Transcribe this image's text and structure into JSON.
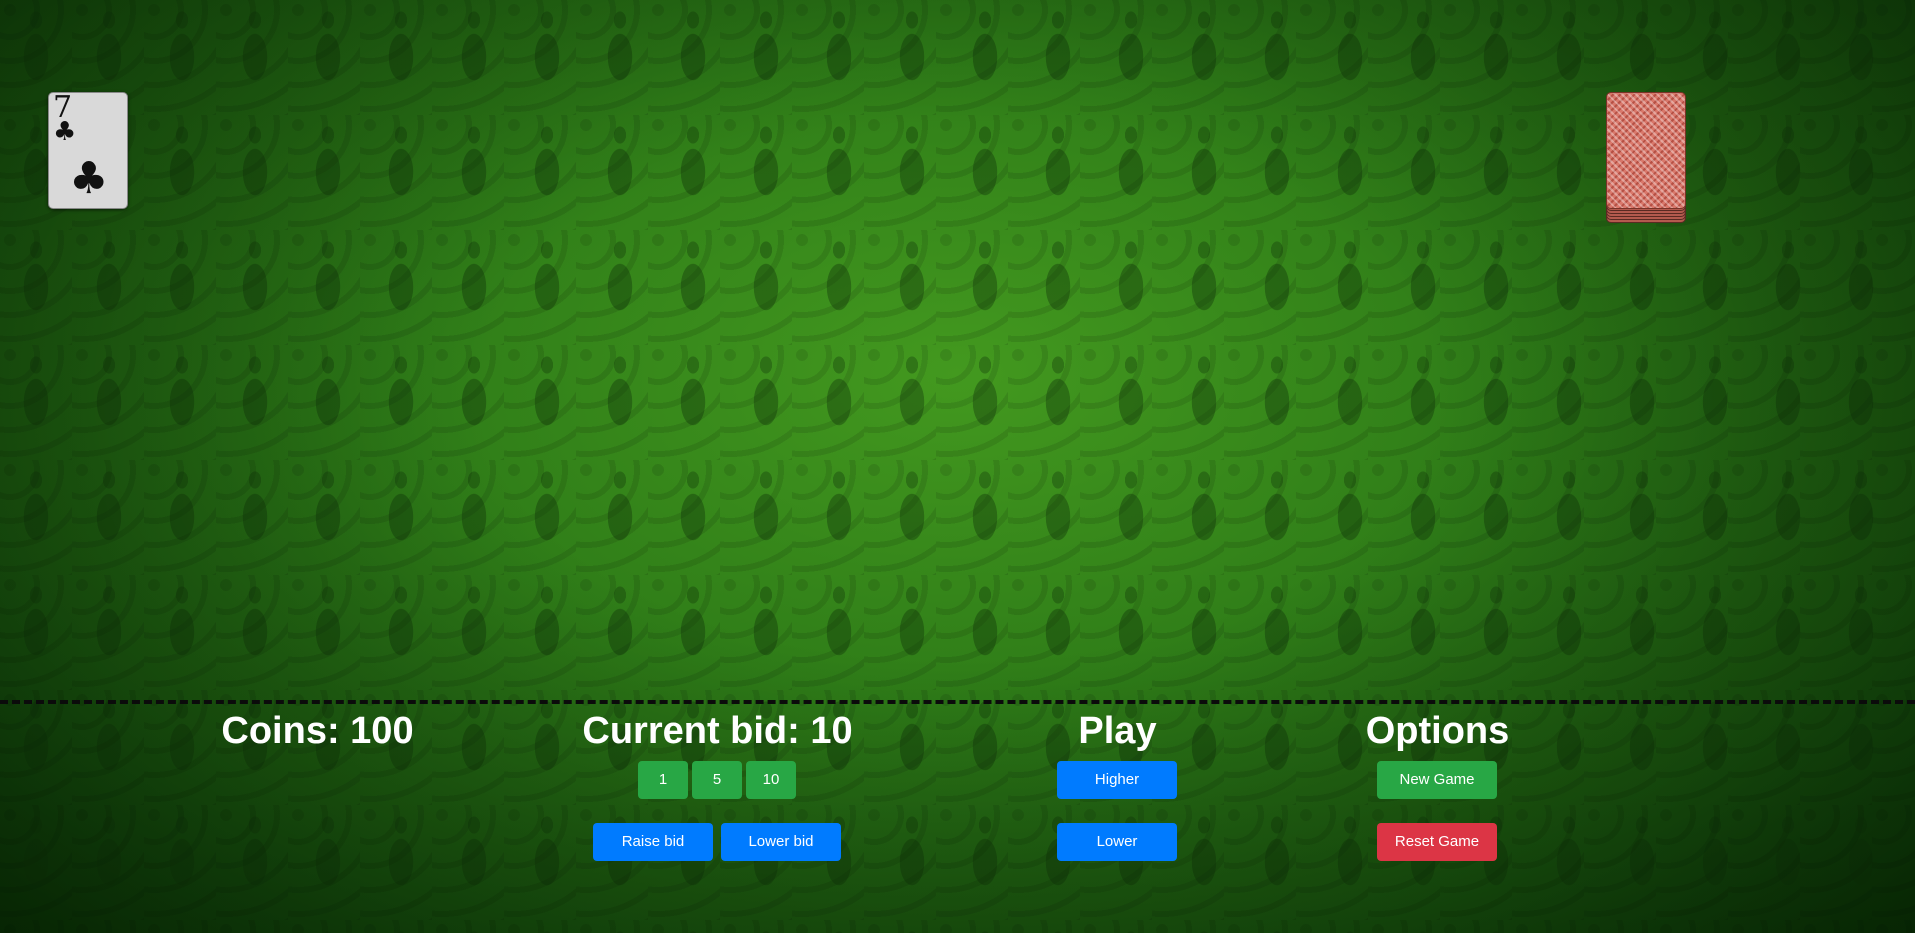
{
  "player_card": {
    "rank": "7",
    "suit": "♣",
    "suit_name": "clubs"
  },
  "deck": {
    "label": "card-back"
  },
  "coins": {
    "title": "Coins: 100",
    "value": 100
  },
  "bid": {
    "title": "Current bid: 10",
    "value": 10,
    "chips": [
      "1",
      "5",
      "10"
    ],
    "raise_label": "Raise bid",
    "lower_label": "Lower bid"
  },
  "play": {
    "title": "Play",
    "higher_label": "Higher",
    "lower_label": "Lower"
  },
  "options": {
    "title": "Options",
    "new_game_label": "New Game",
    "reset_label": "Reset Game"
  },
  "colors": {
    "table_green": "#2f7d18",
    "button_green": "#28a745",
    "button_blue": "#007bff",
    "button_red": "#dc3545"
  }
}
